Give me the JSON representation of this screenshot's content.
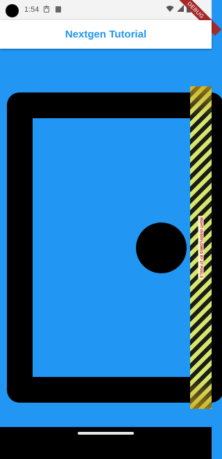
{
  "status_bar": {
    "time": "1:54",
    "icons": [
      "camera-cutout",
      "text-a-icon",
      "sd-card-icon",
      "wifi-icon",
      "signal-icon",
      "battery-icon"
    ],
    "debug_banner": "DEBUG"
  },
  "app_bar": {
    "title": "Nextgen Tutorial"
  },
  "overflow_warning": {
    "label": "RIGHT OVERFLOWED BY 27 PIXELS",
    "stripe_colors": [
      "#d6e86a",
      "#1b1b1b"
    ]
  },
  "colors": {
    "background": "#2196f3",
    "app_bar_title": "#2196f3",
    "frame": "#000000",
    "debug_banner": "#a52a2a"
  }
}
